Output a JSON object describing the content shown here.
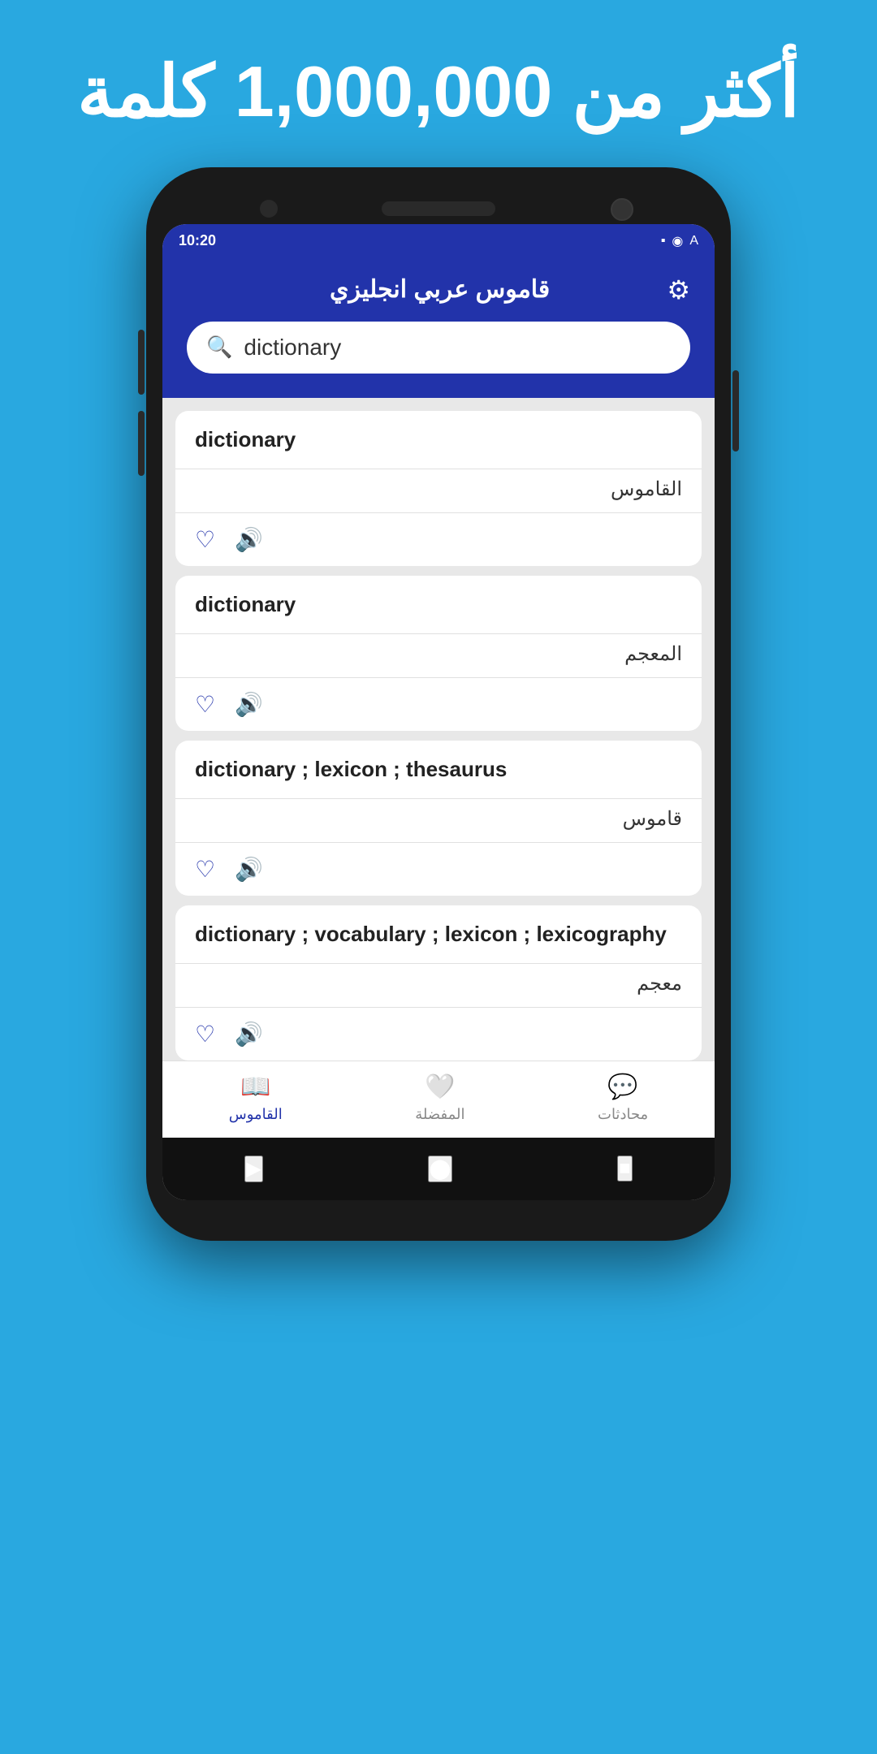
{
  "banner": {
    "title": "أكثر من 1,000,000 كلمة"
  },
  "status_bar": {
    "time": "10:20",
    "icons": [
      "battery",
      "signal",
      "wifi",
      "A"
    ]
  },
  "header": {
    "title": "قاموس عربي انجليزي",
    "gear_label": "⚙"
  },
  "search": {
    "placeholder": "dictionary",
    "value": "dictionary",
    "icon": "🔍"
  },
  "results": [
    {
      "english": "dictionary",
      "arabic": "القاموس"
    },
    {
      "english": "dictionary",
      "arabic": "المعجم"
    },
    {
      "english": "dictionary ; lexicon ; thesaurus",
      "arabic": "قاموس"
    },
    {
      "english": "dictionary ; vocabulary ; lexicon ; lexicography",
      "arabic": "معجم"
    }
  ],
  "bottom_nav": [
    {
      "label": "القاموس",
      "icon": "📖",
      "active": true
    },
    {
      "label": "المفضلة",
      "icon": "🤍",
      "active": false
    },
    {
      "label": "محادثات",
      "icon": "💬",
      "active": false
    }
  ],
  "android_nav": {
    "back": "▶",
    "home": "⬤",
    "recent": "■"
  }
}
